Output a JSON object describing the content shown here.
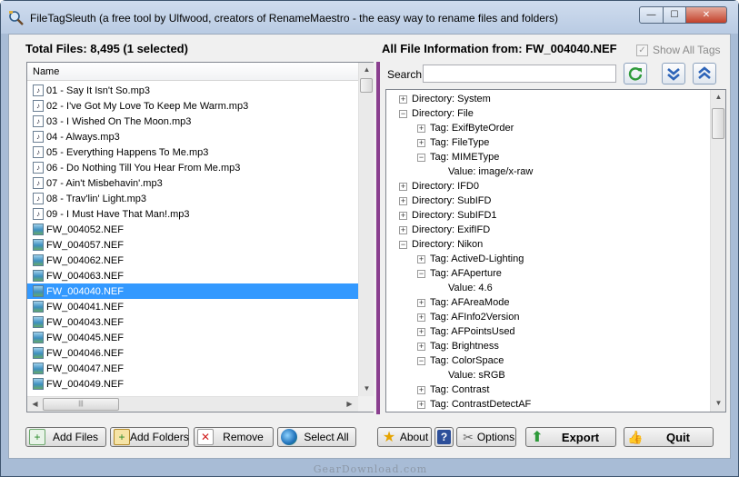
{
  "window": {
    "title": "FileTagSleuth (a free tool by Ulfwood, creators of RenameMaestro - the easy way to rename files and folders)",
    "controls": {
      "minimize": "—",
      "maximize": "☐",
      "close": "✕"
    }
  },
  "files_panel": {
    "total_label": "Total Files: 8,495 (1 selected)",
    "column_header": "Name",
    "files": [
      {
        "name": "01 - Say It Isn't So.mp3",
        "type": "mp3",
        "selected": false
      },
      {
        "name": "02 - I've Got My Love To Keep Me Warm.mp3",
        "type": "mp3",
        "selected": false
      },
      {
        "name": "03 - I Wished On The Moon.mp3",
        "type": "mp3",
        "selected": false
      },
      {
        "name": "04 - Always.mp3",
        "type": "mp3",
        "selected": false
      },
      {
        "name": "05 - Everything Happens To Me.mp3",
        "type": "mp3",
        "selected": false
      },
      {
        "name": "06 - Do Nothing Till You Hear From Me.mp3",
        "type": "mp3",
        "selected": false
      },
      {
        "name": "07 - Ain't Misbehavin'.mp3",
        "type": "mp3",
        "selected": false
      },
      {
        "name": "08 - Trav'lin' Light.mp3",
        "type": "mp3",
        "selected": false
      },
      {
        "name": "09 - I Must Have That Man!.mp3",
        "type": "mp3",
        "selected": false
      },
      {
        "name": "FW_004052.NEF",
        "type": "nef",
        "selected": false
      },
      {
        "name": "FW_004057.NEF",
        "type": "nef",
        "selected": false
      },
      {
        "name": "FW_004062.NEF",
        "type": "nef",
        "selected": false
      },
      {
        "name": "FW_004063.NEF",
        "type": "nef",
        "selected": false
      },
      {
        "name": "FW_004040.NEF",
        "type": "nef",
        "selected": true
      },
      {
        "name": "FW_004041.NEF",
        "type": "nef",
        "selected": false
      },
      {
        "name": "FW_004043.NEF",
        "type": "nef",
        "selected": false
      },
      {
        "name": "FW_004045.NEF",
        "type": "nef",
        "selected": false
      },
      {
        "name": "FW_004046.NEF",
        "type": "nef",
        "selected": false
      },
      {
        "name": "FW_004047.NEF",
        "type": "nef",
        "selected": false
      },
      {
        "name": "FW_004049.NEF",
        "type": "nef",
        "selected": false
      }
    ]
  },
  "info_panel": {
    "header": "All File Information from: FW_004040.NEF",
    "show_all_tags": {
      "label": "Show All Tags",
      "checked": true,
      "enabled": false
    },
    "search_label": "Search",
    "search_value": "",
    "refresh_icon": "refresh-icon",
    "expand_icon": "expand-all-icon",
    "collapse_icon": "collapse-all-icon",
    "tree": [
      {
        "text": "Directory: System",
        "depth": 0,
        "expander": "+"
      },
      {
        "text": "Directory: File",
        "depth": 0,
        "expander": "−"
      },
      {
        "text": "Tag: ExifByteOrder",
        "depth": 1,
        "expander": "+"
      },
      {
        "text": "Tag: FileType",
        "depth": 1,
        "expander": "+"
      },
      {
        "text": "Tag: MIMEType",
        "depth": 1,
        "expander": "−"
      },
      {
        "text": "Value: image/x-raw",
        "depth": 2,
        "expander": ""
      },
      {
        "text": "Directory: IFD0",
        "depth": 0,
        "expander": "+"
      },
      {
        "text": "Directory: SubIFD",
        "depth": 0,
        "expander": "+"
      },
      {
        "text": "Directory: SubIFD1",
        "depth": 0,
        "expander": "+"
      },
      {
        "text": "Directory: ExifIFD",
        "depth": 0,
        "expander": "+"
      },
      {
        "text": "Directory: Nikon",
        "depth": 0,
        "expander": "−"
      },
      {
        "text": "Tag: ActiveD-Lighting",
        "depth": 1,
        "expander": "+"
      },
      {
        "text": "Tag: AFAperture",
        "depth": 1,
        "expander": "−"
      },
      {
        "text": "Value: 4.6",
        "depth": 2,
        "expander": ""
      },
      {
        "text": "Tag: AFAreaMode",
        "depth": 1,
        "expander": "+"
      },
      {
        "text": "Tag: AFInfo2Version",
        "depth": 1,
        "expander": "+"
      },
      {
        "text": "Tag: AFPointsUsed",
        "depth": 1,
        "expander": "+"
      },
      {
        "text": "Tag: Brightness",
        "depth": 1,
        "expander": "+"
      },
      {
        "text": "Tag: ColorSpace",
        "depth": 1,
        "expander": "−"
      },
      {
        "text": "Value: sRGB",
        "depth": 2,
        "expander": ""
      },
      {
        "text": "Tag: Contrast",
        "depth": 1,
        "expander": "+"
      },
      {
        "text": "Tag: ContrastDetectAF",
        "depth": 1,
        "expander": "+"
      }
    ]
  },
  "buttons": {
    "add_files": "Add Files",
    "add_folders": "Add Folders",
    "remove": "Remove",
    "select_all": "Select All",
    "about": "About",
    "help": "?",
    "options": "Options",
    "export": "Export",
    "quit": "Quit"
  },
  "watermark": "GearDownload.com",
  "colors": {
    "selection": "#3399ff",
    "splitter": "#8a3f8f",
    "window_frame": "#a8bcd6"
  }
}
